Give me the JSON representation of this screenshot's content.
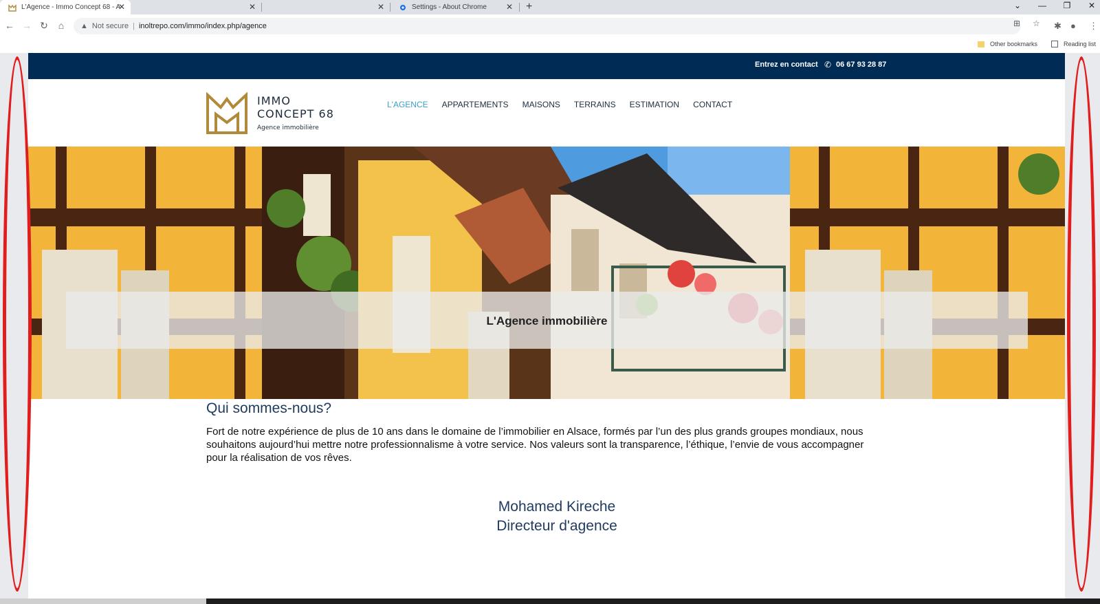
{
  "browser": {
    "tabs": [
      {
        "title": "L'Agence - Immo Concept 68 - A",
        "active": true
      },
      {
        "title": "",
        "active": false
      },
      {
        "title": "",
        "active": false
      },
      {
        "title": "Settings - About Chrome",
        "active": false
      }
    ],
    "address": {
      "security_label": "Not secure",
      "url": "inoltrepo.com/immo/index.php/agence"
    },
    "bookmarks": {
      "other": "Other bookmarks",
      "reading_list": "Reading list"
    }
  },
  "site": {
    "topbar": {
      "contact_label": "Entrez en contact",
      "phone": "06 67 93 28 87"
    },
    "logo": {
      "line1": "IMMO",
      "line2": "CONCEPT 68",
      "tagline": "Agence immobilière"
    },
    "nav": [
      "L'AGENCE",
      "APPARTEMENTS",
      "MAISONS",
      "TERRAINS",
      "ESTIMATION",
      "CONTACT"
    ],
    "hero_title": "L'Agence immobilière",
    "about": {
      "title": "Qui sommes-nous?",
      "text": "Fort de notre expérience de plus de 10 ans dans le domaine de l’immobilier en Alsace, formés par l’un des plus grands groupes mondiaux, nous souhaitons aujourd’hui mettre notre professionnalisme à votre service. Nos valeurs sont la transparence, l’éthique, l’envie de vous accompagner pour la réalisation de vos rêves."
    },
    "person": {
      "name": "Mohamed Kireche",
      "role": "Directeur d'agence"
    }
  },
  "colors": {
    "topbar": "#002b55",
    "nav_active": "#3aa0c8",
    "logo_gold": "#b08a3a",
    "heading": "#1f3a5f",
    "annotation": "#e01e1e"
  }
}
